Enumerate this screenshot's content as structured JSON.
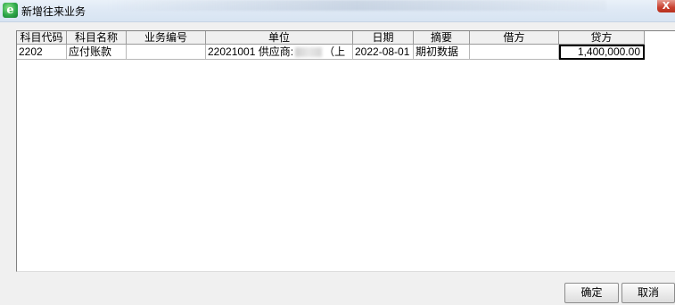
{
  "window": {
    "title": "新增往来业务",
    "close_label": "X",
    "icon": "app-e-icon",
    "icon_glyph": "e"
  },
  "grid": {
    "columns": [
      "科目代码",
      "科目名称",
      "业务编号",
      "单位",
      "日期",
      "摘要",
      "借方",
      "贷方"
    ],
    "rows": [
      {
        "account_code": "2202",
        "account_name": "应付账款",
        "business_no": "",
        "unit_prefix": "22021001 供应商:",
        "unit_suffix": "（上",
        "date": "2022-08-01",
        "summary": "期初数据",
        "debit": "",
        "credit": "1,400,000.00"
      }
    ]
  },
  "buttons": {
    "ok": "确定",
    "cancel": "取消"
  }
}
